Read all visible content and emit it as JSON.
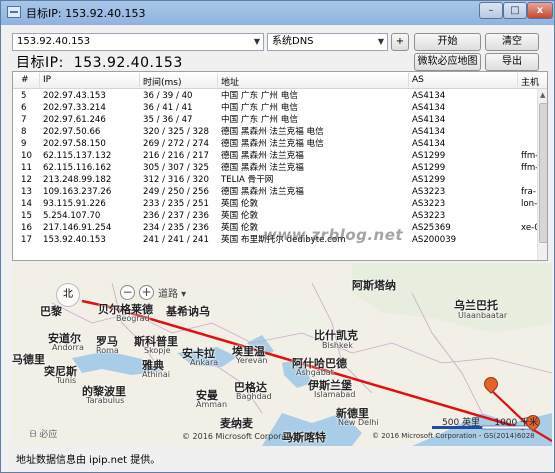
{
  "window": {
    "title": "目标IP: 153.92.40.153",
    "min_label": "–",
    "max_label": "□",
    "close_label": "x"
  },
  "toolbar": {
    "ip_value": "153.92.40.153",
    "dns_value": "系统DNS",
    "plus_label": "+",
    "start_label": "开始",
    "clear_label": "清空",
    "map_label": "微软必应地图",
    "export_label": "导出"
  },
  "target": {
    "label": "目标IP:",
    "value": "153.92.40.153"
  },
  "table": {
    "headers": {
      "no": "#",
      "ip": "IP",
      "time": "时间(ms)",
      "addr": "地址",
      "as": "AS",
      "host": "主机"
    },
    "rows": [
      {
        "no": "5",
        "ip": "202.97.43.153",
        "time": "36 / 39 / 40",
        "addr": "中国 广东 广州 电信",
        "as": "AS4134",
        "host": ""
      },
      {
        "no": "6",
        "ip": "202.97.33.214",
        "time": "36 / 41 / 41",
        "addr": "中国 广东 广州 电信",
        "as": "AS4134",
        "host": ""
      },
      {
        "no": "7",
        "ip": "202.97.61.246",
        "time": "35 / 36 / 47",
        "addr": "中国 广东 广州 电信",
        "as": "AS4134",
        "host": ""
      },
      {
        "no": "8",
        "ip": "202.97.50.66",
        "time": "320 / 325 / 328",
        "addr": "德国 黑森州 法兰克福 电信",
        "as": "AS4134",
        "host": ""
      },
      {
        "no": "9",
        "ip": "202.97.58.150",
        "time": "269 / 272 / 274",
        "addr": "德国 黑森州 法兰克福 电信",
        "as": "AS4134",
        "host": ""
      },
      {
        "no": "10",
        "ip": "62.115.137.132",
        "time": "216 / 216 / 217",
        "addr": "德国 黑森州 法兰克福",
        "as": "AS1299",
        "host": "ffm-"
      },
      {
        "no": "11",
        "ip": "62.115.116.162",
        "time": "305 / 307 / 325",
        "addr": "德国 黑森州 法兰克福",
        "as": "AS1299",
        "host": "ffm-"
      },
      {
        "no": "12",
        "ip": "213.248.99.182",
        "time": "312 / 316 / 320",
        "addr": "TELIA 骨干网",
        "as": "AS1299",
        "host": ""
      },
      {
        "no": "13",
        "ip": "109.163.237.26",
        "time": "249 / 250 / 256",
        "addr": "德国 黑森州 法兰克福",
        "as": "AS3223",
        "host": "fra-"
      },
      {
        "no": "14",
        "ip": "93.115.91.226",
        "time": "233 / 235 / 251",
        "addr": "英国 伦敦",
        "as": "AS3223",
        "host": "lon-"
      },
      {
        "no": "15",
        "ip": "5.254.107.70",
        "time": "236 / 237 / 236",
        "addr": "英国 伦敦",
        "as": "AS3223",
        "host": ""
      },
      {
        "no": "16",
        "ip": "217.146.91.254",
        "time": "234 / 235 / 236",
        "addr": "英国 伦敦",
        "as": "AS25369",
        "host": "xe-0"
      },
      {
        "no": "17",
        "ip": "153.92.40.153",
        "time": "241 / 241 / 241",
        "addr": "英国 布里斯托尔 dedibyte.com",
        "as": "AS200039",
        "host": ""
      }
    ]
  },
  "watermark": "www.zrblog.net",
  "map": {
    "road_label": "道路",
    "compass_label": "北",
    "zoom_out": "−",
    "zoom_in": "+",
    "bing_label": "必应",
    "scale_label": "500 英里",
    "scale_km": "1000 千米",
    "copyright1": "© 2016 Microsoft Corporation",
    "copyright2": "© 2016 Microsoft Corporation",
    "copyright3": "© 2016 Microsoft Corporation - GS(2014)6028",
    "labels": {
      "bali": "巴黎",
      "beierge": "贝尔格莱德",
      "jibu": "基希讷乌",
      "hanbao": "阿斯塔纳",
      "wulan": "乌兰巴托",
      "wulan_small": "Ulaanbaatar",
      "andaoer": "安道尔",
      "andaoer_small": "Andorra",
      "luoma": "罗马",
      "luoma_small": "Roma",
      "sikepuli": "斯科普里",
      "sikepuli_small": "Skopje",
      "ankala": "安卡拉",
      "ankala_small": "Ankara",
      "elevan": "埃里温",
      "elevan_small": "Yerevan",
      "bishikaike": "比什凯克",
      "bishikaike_small": "Bishkek",
      "ashigabat": "阿什哈巴德",
      "ashigabat_small": "Ashgabat",
      "madeli": "马德里",
      "tunisi": "突尼斯",
      "tunisi_small": "Tunis",
      "yadian": "雅典",
      "yadian_small": "Athinai",
      "libuli": "的黎波里",
      "libuli_small": "Tarabulus",
      "anman": "安曼",
      "anman_small": "Amman",
      "bageda": "巴格达",
      "bageda_small": "Baghdad",
      "yisilanbao": "伊斯兰堡",
      "yisilanbao_small": "Islamabad",
      "xindeli": "新德里",
      "xindeli_small": "New Delhi",
      "maijiana": "麦纳麦",
      "masikate": "马斯喀特",
      "beibuda": "贝尔格莱德",
      "beibuda_small": "Beograd"
    }
  },
  "status": "地址数据信息由 ipip.net 提供。"
}
